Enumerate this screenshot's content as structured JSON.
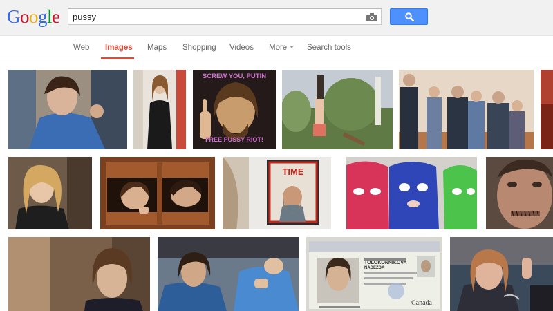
{
  "logo": {
    "letters": [
      "G",
      "o",
      "o",
      "g",
      "l",
      "e"
    ]
  },
  "search": {
    "query": "pussy"
  },
  "icons": {
    "camera": "camera-icon",
    "search": "magnifier-icon"
  },
  "nav": {
    "items": [
      {
        "label": "Web",
        "active": false
      },
      {
        "label": "Images",
        "active": true
      },
      {
        "label": "Maps",
        "active": false
      },
      {
        "label": "Shopping",
        "active": false
      },
      {
        "label": "Videos",
        "active": false
      },
      {
        "label": "More",
        "active": false,
        "dropdown": true
      },
      {
        "label": "Search tools",
        "active": false
      }
    ]
  },
  "results": {
    "poster_text_top": "SCREW YOU, PUTIN",
    "poster_text_bottom": "FREE PUSSY RIOT!",
    "magazine_title": "TIME",
    "id_card_name": "TOLOKONNIKOVA",
    "id_card_given": "NADEZDA",
    "id_card_brand": "Canada"
  },
  "colors": {
    "accent": "#dd4b39",
    "button": "#4d90fe"
  }
}
